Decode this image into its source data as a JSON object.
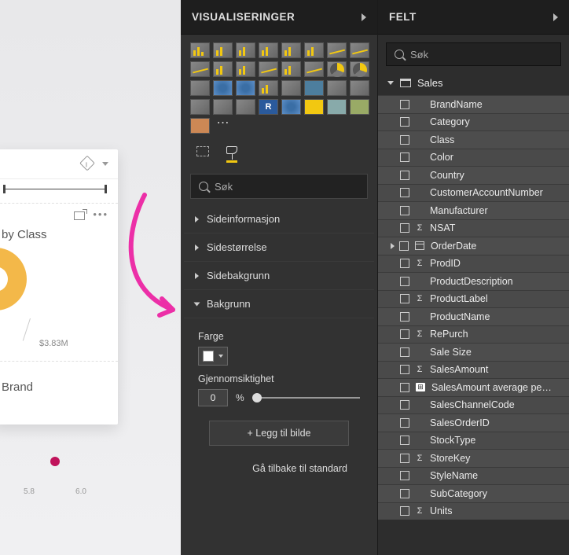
{
  "canvas": {
    "title1": "by Class",
    "datalabel": "$3.83M",
    "title2": "Brand",
    "axis": [
      "5.8",
      "6.0"
    ]
  },
  "viz_panel": {
    "header": "VISUALISERINGER",
    "search_placeholder": "Søk",
    "sections": {
      "pageinfo": "Sideinformasjon",
      "pagesize": "Sidestørrelse",
      "pagebg": "Sidebakgrunn",
      "bg": "Bakgrunn"
    },
    "color_label": "Farge",
    "transparency_label": "Gjennomsiktighet",
    "transparency_value": "0",
    "pct": "%",
    "add_image": "+ Legg til bilde",
    "reset": "Gå tilbake til standard"
  },
  "fields_panel": {
    "header": "FELT",
    "search_placeholder": "Søk",
    "table": "Sales",
    "fields": [
      {
        "name": "BrandName",
        "kind": "text"
      },
      {
        "name": "Category",
        "kind": "text"
      },
      {
        "name": "Class",
        "kind": "text"
      },
      {
        "name": "Color",
        "kind": "text"
      },
      {
        "name": "Country",
        "kind": "text"
      },
      {
        "name": "CustomerAccountNumber",
        "kind": "text"
      },
      {
        "name": "Manufacturer",
        "kind": "text"
      },
      {
        "name": "NSAT",
        "kind": "sigma"
      },
      {
        "name": "OrderDate",
        "kind": "date",
        "expandable": true
      },
      {
        "name": "ProdID",
        "kind": "sigma"
      },
      {
        "name": "ProductDescription",
        "kind": "text"
      },
      {
        "name": "ProductLabel",
        "kind": "sigma"
      },
      {
        "name": "ProductName",
        "kind": "text"
      },
      {
        "name": "RePurch",
        "kind": "sigma"
      },
      {
        "name": "Sale Size",
        "kind": "text"
      },
      {
        "name": "SalesAmount",
        "kind": "sigma"
      },
      {
        "name": "SalesAmount average pe…",
        "kind": "calc"
      },
      {
        "name": "SalesChannelCode",
        "kind": "text"
      },
      {
        "name": "SalesOrderID",
        "kind": "text"
      },
      {
        "name": "StockType",
        "kind": "text"
      },
      {
        "name": "StoreKey",
        "kind": "sigma"
      },
      {
        "name": "StyleName",
        "kind": "text"
      },
      {
        "name": "SubCategory",
        "kind": "text"
      },
      {
        "name": "Units",
        "kind": "sigma"
      }
    ]
  }
}
